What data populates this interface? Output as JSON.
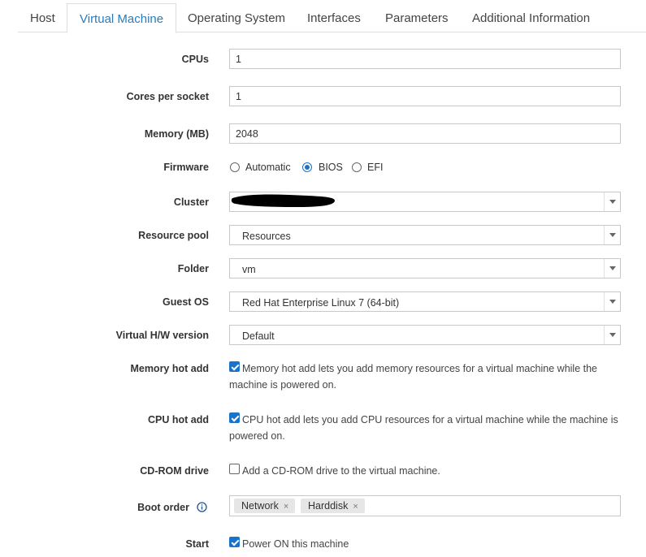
{
  "tabs": [
    {
      "label": "Host"
    },
    {
      "label": "Virtual Machine",
      "active": true
    },
    {
      "label": "Operating System"
    },
    {
      "label": "Interfaces"
    },
    {
      "label": "Parameters"
    },
    {
      "label": "Additional Information"
    }
  ],
  "form": {
    "cpus": {
      "label": "CPUs",
      "value": "1"
    },
    "cores": {
      "label": "Cores per socket",
      "value": "1"
    },
    "memory": {
      "label": "Memory (MB)",
      "value": "2048"
    },
    "firmware": {
      "label": "Firmware",
      "options": [
        "Automatic",
        "BIOS",
        "EFI"
      ],
      "selected": "BIOS"
    },
    "cluster": {
      "label": "Cluster",
      "value": ""
    },
    "resource_pool": {
      "label": "Resource pool",
      "value": "Resources"
    },
    "folder": {
      "label": "Folder",
      "value": "vm"
    },
    "guest_os": {
      "label": "Guest OS",
      "value": "Red Hat Enterprise Linux 7 (64-bit)"
    },
    "hw_version": {
      "label": "Virtual H/W version",
      "value": "Default"
    },
    "memory_hot_add": {
      "label": "Memory hot add",
      "checked": true,
      "line1": "Memory hot add lets you add memory resources for a virtual machine while the",
      "line2": "machine is powered on."
    },
    "cpu_hot_add": {
      "label": "CPU hot add",
      "checked": true,
      "line1": "CPU hot add lets you add CPU resources for a virtual machine while the machine is",
      "line2": "powered on."
    },
    "cdrom": {
      "label": "CD-ROM drive",
      "checked": false,
      "text": "Add a CD-ROM drive to the virtual machine."
    },
    "boot_order": {
      "label": "Boot order",
      "items": [
        "Network",
        "Harddisk"
      ]
    },
    "start": {
      "label": "Start",
      "checked": true,
      "text": "Power ON this machine"
    }
  },
  "colors": {
    "accent": "#1a73c9",
    "tab_active": "#2b7bb9"
  }
}
